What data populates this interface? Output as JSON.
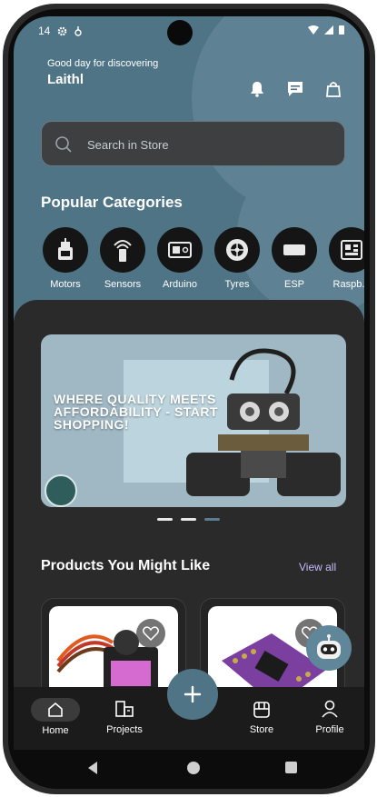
{
  "status_bar": {
    "time": "14"
  },
  "header": {
    "greeting": "Good day for discovering",
    "username": "Laithl"
  },
  "search": {
    "placeholder": "Search in Store"
  },
  "categories": {
    "title": "Popular Categories",
    "items": [
      {
        "label": "Motors",
        "icon": "motor-icon"
      },
      {
        "label": "Sensors",
        "icon": "sensor-icon"
      },
      {
        "label": "Arduino",
        "icon": "arduino-board-icon"
      },
      {
        "label": "Tyres",
        "icon": "tyre-icon"
      },
      {
        "label": "ESP",
        "icon": "esp-module-icon"
      },
      {
        "label": "Raspb...",
        "icon": "raspberry-board-icon"
      }
    ]
  },
  "banner": {
    "headline": "WHERE QUALITY MEETS AFFORDABILITY - START SHOPPING!",
    "slide_count": 3,
    "active_slide": 3
  },
  "products": {
    "title": "Products You Might Like",
    "view_all": "View all"
  },
  "bottom_nav": {
    "home": "Home",
    "projects": "Projects",
    "store": "Store",
    "profile": "Profile"
  },
  "colors": {
    "accent": "#4f7486",
    "view_all": "#c7b8ff",
    "dark_bg": "#2a2a2a"
  }
}
